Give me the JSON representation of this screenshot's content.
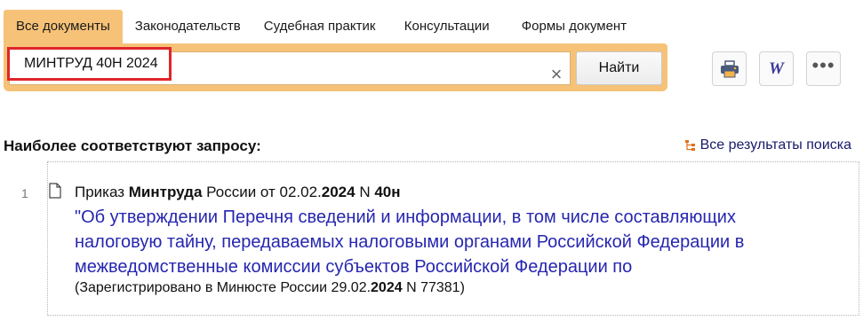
{
  "tabs": [
    {
      "label": "Все документы",
      "active": true
    },
    {
      "label": "Законодательств",
      "active": false
    },
    {
      "label": "Судебная практик",
      "active": false
    },
    {
      "label": "Консультации",
      "active": false
    },
    {
      "label": "Формы документ",
      "active": false
    }
  ],
  "search": {
    "value": "МИНТРУД 40Н 2024",
    "clear_symbol": "×",
    "button_label": "Найти"
  },
  "toolbar": {
    "icons": [
      "printer-icon",
      "word-export-icon",
      "more-icon"
    ],
    "word_letter": "W",
    "more_symbol": "•••"
  },
  "results": {
    "heading": "Наиболее соответствуют запросу:",
    "all_results_label": "Все результаты поиска",
    "items": [
      {
        "number": "1",
        "line1": {
          "p1": "Приказ ",
          "b1": "Минтруда",
          "p2": " России от 02.02.",
          "b2": "2024",
          "p3": " N ",
          "b3": "40н"
        },
        "title_lines": [
          "\"Об утверждении Перечня сведений и информации, в том числе составляющих",
          "налоговую тайну, передаваемых налоговыми органами Российской Федерации в",
          "межведомственные комиссии субъектов Российской Федерации по"
        ],
        "reg": {
          "p1": "(Зарегистрировано в Минюсте России 29.02.",
          "b1": "2024",
          "p2": " N 77381)"
        }
      }
    ]
  },
  "colors": {
    "accent": "#f6c278",
    "highlight_border": "#e0252a",
    "link": "#2626b0"
  }
}
